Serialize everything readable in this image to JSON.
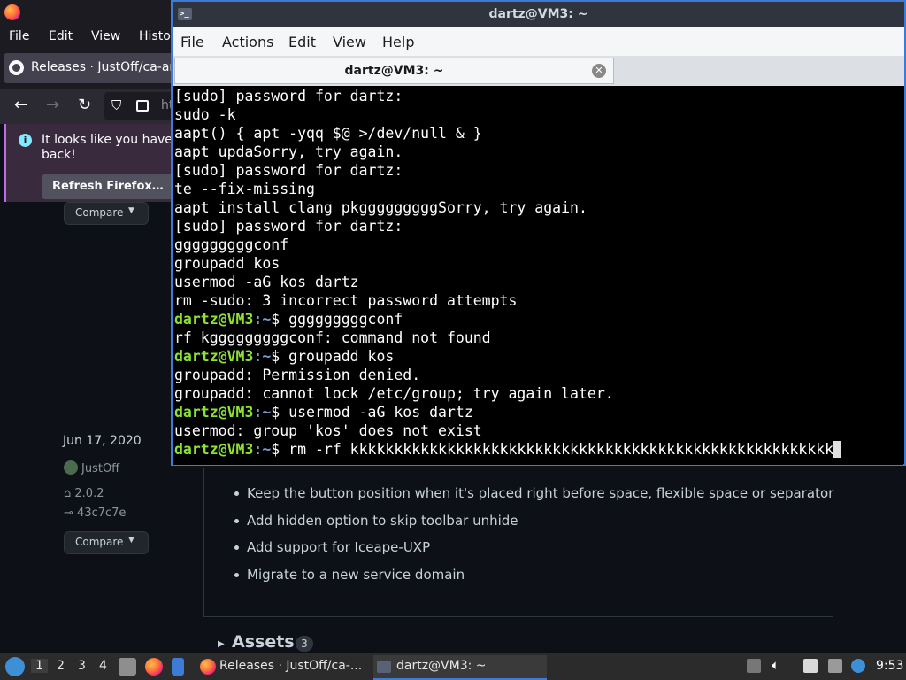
{
  "firefox": {
    "menu": [
      "File",
      "Edit",
      "View",
      "Histo"
    ],
    "tab_title": "Releases · JustOff/ca-arc",
    "url_partial": "ht",
    "notice_message_line1": "It looks like you haven",
    "notice_message_line2": "back!",
    "refresh_button": "Refresh Firefox…",
    "compare_label": "Compare",
    "release_date": "Jun 17, 2020",
    "release_author": "JustOff",
    "release_tag": "2.0.2",
    "release_commit": "43c7c7e",
    "notes": [
      "Keep the button position when it's placed right before space, flexible space or separator",
      "Add hidden option to skip toolbar unhide",
      "Add support for Iceape-UXP",
      "Migrate to a new service domain"
    ],
    "assets_label": "Assets",
    "assets_count": "3"
  },
  "terminal": {
    "title": "dartz@VM3: ~",
    "menu": [
      "File",
      "Actions",
      "Edit",
      "View",
      "Help"
    ],
    "tab_label": "dartz@VM3: ~",
    "prompt_user": "dartz@VM3",
    "prompt_path": ":~",
    "lines": [
      {
        "type": "out",
        "text": "[sudo] password for dartz:"
      },
      {
        "type": "out",
        "text": "sudo -k"
      },
      {
        "type": "out",
        "text": "aapt() { apt -yqq $@ >/dev/null & }"
      },
      {
        "type": "out",
        "text": "aapt updaSorry, try again."
      },
      {
        "type": "out",
        "text": "[sudo] password for dartz:"
      },
      {
        "type": "out",
        "text": "te --fix-missing"
      },
      {
        "type": "out",
        "text": "aapt install clang pkgggggggggSorry, try again."
      },
      {
        "type": "out",
        "text": "[sudo] password for dartz:"
      },
      {
        "type": "out",
        "text": "gggggggggconf"
      },
      {
        "type": "out",
        "text": "groupadd kos"
      },
      {
        "type": "out",
        "text": "usermod -aG kos dartz"
      },
      {
        "type": "out",
        "text": "rm -sudo: 3 incorrect password attempts"
      },
      {
        "type": "prompt",
        "text": "$ gggggggggconf"
      },
      {
        "type": "out",
        "text": "rf kgggggggggconf: command not found"
      },
      {
        "type": "prompt",
        "text": "$ groupadd kos"
      },
      {
        "type": "out",
        "text": "groupadd: Permission denied."
      },
      {
        "type": "out",
        "text": "groupadd: cannot lock /etc/group; try again later."
      },
      {
        "type": "prompt",
        "text": "$ usermod -aG kos dartz"
      },
      {
        "type": "out",
        "text": "usermod: group 'kos' does not exist"
      },
      {
        "type": "prompt",
        "text": "$ rm -rf kkkkkkkkkkkkkkkkkkkkkkkkkkkkkkkkkkkkkkkkkkkkkkkkkkkkkkk",
        "cursor": true
      }
    ]
  },
  "taskbar": {
    "workspaces": [
      "1",
      "2",
      "3",
      "4"
    ],
    "tasks": [
      "Releases · JustOff/ca-...",
      "dartz@VM3: ~"
    ],
    "clock": "9:53"
  }
}
